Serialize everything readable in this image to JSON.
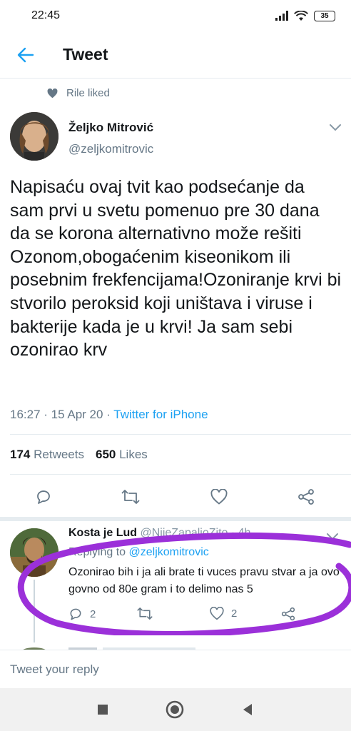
{
  "status_bar": {
    "time": "22:45",
    "battery_level": "35",
    "icons": [
      "signal-icon",
      "wifi-icon",
      "battery-icon"
    ]
  },
  "header": {
    "title": "Tweet",
    "back_icon": "back-arrow-icon"
  },
  "social_context": {
    "text": "Rile liked",
    "icon": "heart-icon"
  },
  "tweet": {
    "author_name": "Željko Mitrović",
    "author_handle": "@zeljkomitrovic",
    "text": "Napisaću ovaj tvit kao podsećanje da sam prvi u svetu pomenuo pre 30 dana da se korona alternativno može rešiti Ozonom,obogaćenim kiseonikom ili posebnim frekfencijama!Ozoniranje krvi bi stvorilo peroksid koji uništava i viruse i bakterije kada je u krvi! Ja sam sebi ozonirao krv",
    "time": "16:27",
    "date": "15 Apr 20",
    "source": "Twitter for iPhone",
    "retweets_count": "174",
    "retweets_label": "Retweets",
    "likes_count": "650",
    "likes_label": "Likes"
  },
  "actions": [
    "reply-icon",
    "retweet-icon",
    "like-icon",
    "share-icon"
  ],
  "reply": {
    "name": "Kosta je Lud",
    "handle": "@NijeZapalioZito",
    "age": "4h",
    "replying_label": "Replying to",
    "replying_to": "@zeljkomitrovic",
    "text": "Ozonirao bih i ja ali brate ti vuces pravu stvar a ja ovo govno od 80e gram i to delimo nas 5",
    "reply_count": "2",
    "like_count": "2"
  },
  "compose": {
    "placeholder": "Tweet your reply"
  },
  "annotation_color": "#9b30d9",
  "accent_color": "#1da1f2"
}
